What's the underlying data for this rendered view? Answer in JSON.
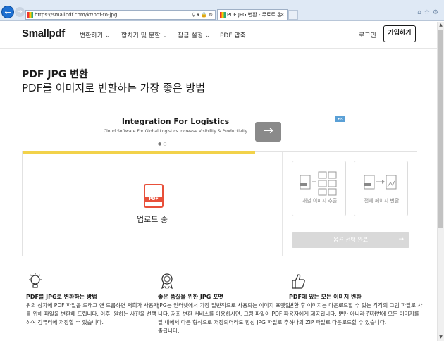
{
  "browser": {
    "url": "https://smallpdf.com/kr/pdf-to-jpg",
    "tab_title": "PDF JPG 변환 - 무료로 온...",
    "tab_close": "×",
    "address_tools": "⚲ ▾ 🔒 ↻"
  },
  "header": {
    "logo": "Smallpdf",
    "nav": [
      "변환하기 ⌄",
      "합치기 및 분할 ⌄",
      "잠금 설정 ⌄",
      "PDF 압축"
    ],
    "login": "로그인",
    "signup": "가입하기"
  },
  "hero": {
    "title": "PDF JPG 변환",
    "subtitle": "PDF를 이미지로 변환하는 가장 좋은 방법"
  },
  "ad": {
    "title": "Integration For Logistics",
    "description": "Cloud Software For Global Logistics Increase Visibility & Productivity",
    "badge": "▸×"
  },
  "tool": {
    "upload_status": "업로드 중",
    "pdf_icon_label": "PDF",
    "progress": 0.59,
    "options": [
      {
        "label": "개별 이미지 추출"
      },
      {
        "label": "전체 페이지 변환"
      }
    ],
    "finish_label": "옵션 선택 완료",
    "finish_arrow": "→"
  },
  "features": [
    {
      "title": "PDF를 JPG로 변환하는 방법",
      "text": "위의 상자에 PDF 파일을 드래그 앤 드롭하면 저희가 사용자를 위해 파일을 변환해 드립니다. 이후, 원하는 사진을 선택하여 컴퓨터에 저장할 수 있습니다."
    },
    {
      "title": "좋은 품질을 위한 JPG 포맷",
      "text": "JPG는 인터넷에서 가장 일반적으로 사용되는 이미지 포맷입니다. 저희 변환 서비스를 이용하시면, 그림 파일이 PDF 파일 내에서 다른 형식으로 저장되더라도 항상 JPG 파일로 추출됩니다."
    },
    {
      "title": "PDF에 있는 모든 이미지 변환",
      "text": "변환 후 이미지는 다운로드할 수 있는 각각의 그림 파일로 사용자에게 제공됩니다. 뿐만 아니라 한꺼번에 모든 이미지를 하나의 ZIP 파일로 다운로드할 수 있습니다."
    }
  ],
  "colors": {
    "progress": "#f2d24a",
    "pdf_icon": "#e8503a",
    "browser_accent": "#1d6fd1"
  }
}
